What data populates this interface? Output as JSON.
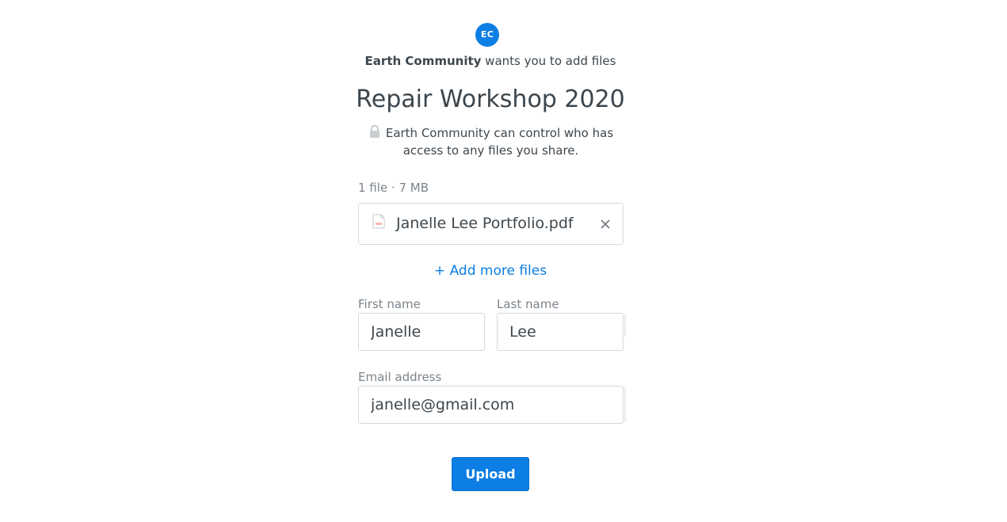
{
  "requester": {
    "initials": "EC",
    "org_name": "Earth Community",
    "request_text": " wants you to add files"
  },
  "request": {
    "title": "Repair Workshop 2020",
    "privacy_notice": "Earth Community can control who has access to any files you share."
  },
  "files": {
    "summary": "1 file · 7 MB",
    "items": [
      {
        "name": "Janelle Lee Portfolio.pdf",
        "icon": "pdf-file-icon"
      }
    ],
    "add_more_label": "+ Add more files"
  },
  "form": {
    "first_name_label": "First name",
    "first_name_value": "Janelle",
    "last_name_label": "Last name",
    "last_name_value": "Lee",
    "email_label": "Email address",
    "email_value": "janelle@gmail.com"
  },
  "actions": {
    "upload_label": "Upload"
  },
  "colors": {
    "accent": "#0d7ee3",
    "text": "#3d464d",
    "muted": "#7b848c",
    "border": "#d5d9dd"
  }
}
